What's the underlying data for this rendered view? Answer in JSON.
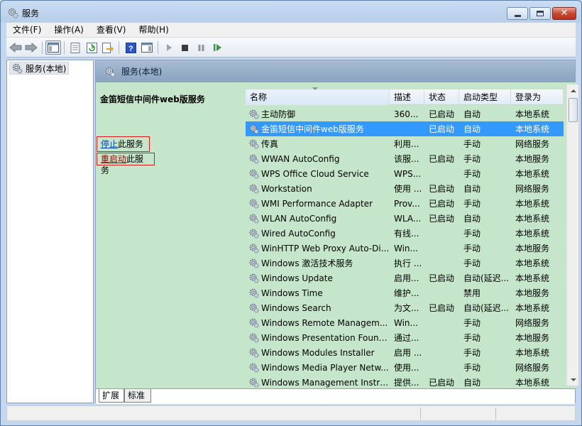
{
  "window": {
    "title": "服务"
  },
  "menu": [
    "文件(F)",
    "操作(A)",
    "查看(V)",
    "帮助(H)"
  ],
  "toolbar": {
    "icons": [
      "back-arrow-icon",
      "forward-arrow-icon",
      "show-hide-tree-icon",
      "properties-icon",
      "refresh-icon",
      "export-list-icon",
      "help-icon",
      "show-hide-action-pane-icon",
      "start-service-icon",
      "stop-service-icon",
      "pause-service-icon",
      "resume-service-icon"
    ]
  },
  "tree": {
    "root": "服务(本地)"
  },
  "main": {
    "header": "服务(本地)",
    "detail": {
      "title": "金笛短信中间件web版服务",
      "stop_link": "停止",
      "stop_suffix": "此服务",
      "restart_link": "重启动",
      "restart_suffix": "此服务"
    },
    "columns": [
      "名称",
      "描述",
      "状态",
      "启动类型",
      "登录为"
    ],
    "rows": [
      {
        "name": "主动防御",
        "desc": "360...",
        "status": "已启动",
        "start": "自动",
        "logon": "本地系统"
      },
      {
        "name": "金笛短信中间件web版服务",
        "desc": "",
        "status": "已启动",
        "start": "自动",
        "logon": "本地系统",
        "selected": true
      },
      {
        "name": "传真",
        "desc": "利用...",
        "status": "",
        "start": "手动",
        "logon": "网络服务"
      },
      {
        "name": "WWAN AutoConfig",
        "desc": "该服...",
        "status": "已启动",
        "start": "手动",
        "logon": "本地服务"
      },
      {
        "name": "WPS Office Cloud Service",
        "desc": "WPS...",
        "status": "",
        "start": "手动",
        "logon": "本地系统"
      },
      {
        "name": "Workstation",
        "desc": "使用 ...",
        "status": "已启动",
        "start": "自动",
        "logon": "网络服务"
      },
      {
        "name": "WMI Performance Adapter",
        "desc": "Prov...",
        "status": "已启动",
        "start": "手动",
        "logon": "本地系统"
      },
      {
        "name": "WLAN AutoConfig",
        "desc": "WLA...",
        "status": "已启动",
        "start": "自动",
        "logon": "本地系统"
      },
      {
        "name": "Wired AutoConfig",
        "desc": "有线...",
        "status": "",
        "start": "手动",
        "logon": "本地系统"
      },
      {
        "name": "WinHTTP Web Proxy Auto-Di...",
        "desc": "Win...",
        "status": "",
        "start": "手动",
        "logon": "本地服务"
      },
      {
        "name": "Windows 激活技术服务",
        "desc": "执行 ...",
        "status": "",
        "start": "手动",
        "logon": "本地系统"
      },
      {
        "name": "Windows Update",
        "desc": "启用...",
        "status": "已启动",
        "start": "自动(延迟...",
        "logon": "本地系统"
      },
      {
        "name": "Windows Time",
        "desc": "维护...",
        "status": "",
        "start": "禁用",
        "logon": "本地服务"
      },
      {
        "name": "Windows Search",
        "desc": "为文...",
        "status": "已启动",
        "start": "自动(延迟...",
        "logon": "本地系统"
      },
      {
        "name": "Windows Remote Managem...",
        "desc": "Win...",
        "status": "",
        "start": "手动",
        "logon": "网络服务"
      },
      {
        "name": "Windows Presentation Found...",
        "desc": "通过...",
        "status": "",
        "start": "手动",
        "logon": "本地服务"
      },
      {
        "name": "Windows Modules Installer",
        "desc": "启用 ...",
        "status": "",
        "start": "手动",
        "logon": "本地系统"
      },
      {
        "name": "Windows Media Player Netw...",
        "desc": "使用...",
        "status": "",
        "start": "手动",
        "logon": "网络服务"
      },
      {
        "name": "Windows Management Instru...",
        "desc": "提供...",
        "status": "已启动",
        "start": "自动",
        "logon": "本地系统"
      }
    ]
  },
  "tabs": [
    "扩展",
    "标准"
  ],
  "colors": {
    "selected_row": "#3399ff",
    "pane_green": "#c5e6cb",
    "header_blue": "#8aa3bf"
  }
}
